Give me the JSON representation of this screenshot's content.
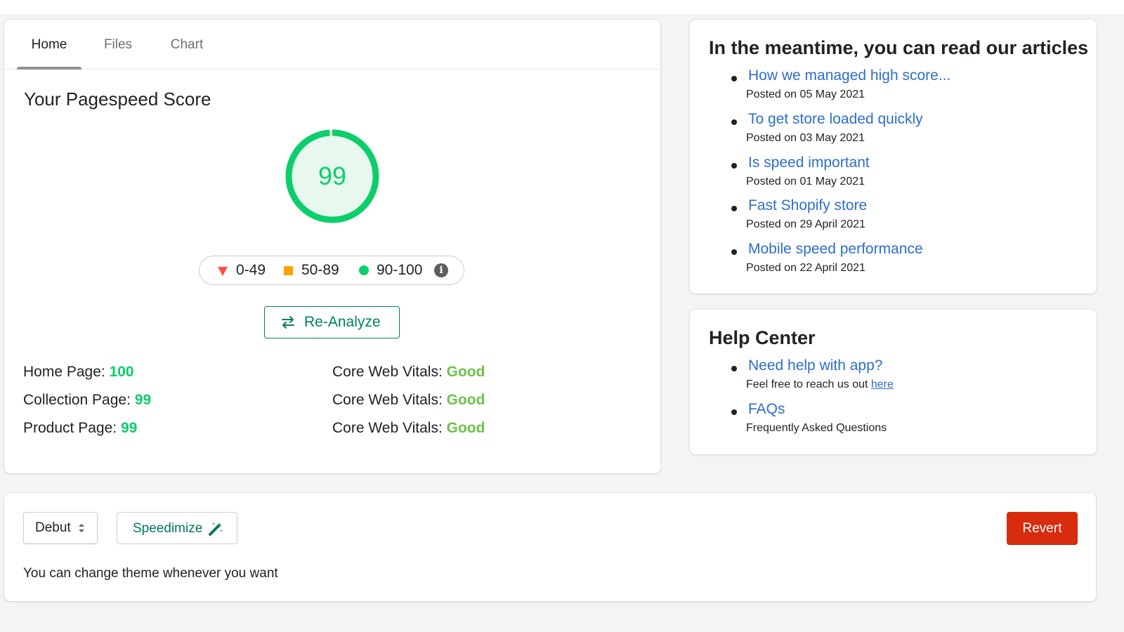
{
  "tabs": [
    {
      "label": "Home",
      "active": true
    },
    {
      "label": "Files",
      "active": false
    },
    {
      "label": "Chart",
      "active": false
    }
  ],
  "score": {
    "title": "Your Pagespeed Score",
    "value": "99",
    "value_fraction": 0.99,
    "color": "#0cce6b"
  },
  "legend": {
    "fail": {
      "label": "0-49",
      "color": "#ff4e42",
      "icon": "triangle-down-icon"
    },
    "average": {
      "label": "50-89",
      "color": "#ffa400",
      "icon": "square-icon"
    },
    "pass": {
      "label": "90-100",
      "color": "#0cce6b",
      "icon": "circle-icon"
    },
    "info_icon": "info-icon"
  },
  "reanalyze": {
    "label": "Re-Analyze",
    "icon": "swap-arrows-icon"
  },
  "metrics": {
    "pages": [
      {
        "label": "Home Page:",
        "value": "100"
      },
      {
        "label": "Collection Page:",
        "value": "99"
      },
      {
        "label": "Product Page:",
        "value": "99"
      }
    ],
    "vitals": [
      {
        "label": "Core Web Vitals:",
        "value": "Good"
      },
      {
        "label": "Core Web Vitals:",
        "value": "Good"
      },
      {
        "label": "Core Web Vitals:",
        "value": "Good"
      }
    ]
  },
  "articles": {
    "title": "In the meantime, you can read our articles",
    "items": [
      {
        "title": "How we managed high score...",
        "date": "Posted on 05 May 2021"
      },
      {
        "title": "To get store loaded quickly",
        "date": "Posted on 03 May 2021"
      },
      {
        "title": "Is speed important",
        "date": "Posted on 01 May 2021"
      },
      {
        "title": "Fast Shopify store",
        "date": "Posted on 29 April 2021"
      },
      {
        "title": "Mobile speed performance",
        "date": "Posted on 22 April 2021"
      }
    ]
  },
  "help": {
    "title": "Help Center",
    "items": [
      {
        "title": "Need help with app?",
        "desc": "Feel free to reach us out ",
        "link": "here"
      },
      {
        "title": "FAQs",
        "desc": "Frequently Asked Questions"
      }
    ]
  },
  "footer": {
    "theme_select": {
      "value": "Debut",
      "icon": "select-arrows-icon"
    },
    "speedimize": {
      "label": "Speedimize",
      "icon": "magic-wand-icon"
    },
    "revert": {
      "label": "Revert"
    },
    "hint": "You can change theme whenever you want"
  },
  "colors": {
    "primary": "#008060",
    "link": "#2c6ecb",
    "critical": "#d72c0d",
    "good": "#6cc24a"
  }
}
